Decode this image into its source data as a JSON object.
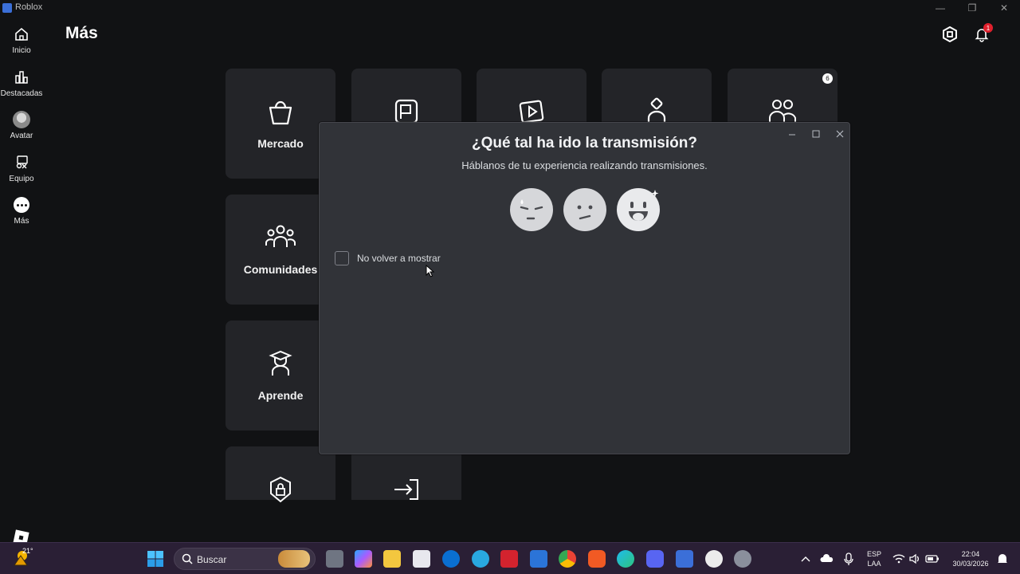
{
  "window": {
    "title": "Roblox",
    "minimize_glyph": "—",
    "restore_glyph": "❐",
    "close_glyph": "✕"
  },
  "sidebar": {
    "items": [
      {
        "label": "Inicio",
        "icon": "home-icon"
      },
      {
        "label": "Destacadas",
        "icon": "bar-chart-icon"
      },
      {
        "label": "Avatar",
        "icon": "avatar-icon"
      },
      {
        "label": "Equipo",
        "icon": "inventory-icon"
      },
      {
        "label": "Más",
        "icon": "more-icon"
      }
    ]
  },
  "header": {
    "title": "Más",
    "notification_count": "1"
  },
  "tiles": [
    {
      "label": "Mercado",
      "icon": "shopping-bag-icon"
    },
    {
      "label": "",
      "icon": "robux-card-icon"
    },
    {
      "label": "",
      "icon": "play-video-icon"
    },
    {
      "label": "",
      "icon": "person-icon"
    },
    {
      "label": "",
      "icon": "friends-icon",
      "badge": "6"
    },
    {
      "label": "Comunidades",
      "icon": "communities-icon"
    },
    {
      "label": "Aprende",
      "icon": "graduation-icon"
    },
    {
      "label": "",
      "icon": "lock-shield-icon"
    },
    {
      "label": "",
      "icon": "sign-in-icon"
    }
  ],
  "dialog": {
    "title": "¿Qué tal ha ido la transmisión?",
    "subtitle": "Háblanos de tu experiencia realizando transmisiones.",
    "faces": [
      "sad-face-icon",
      "neutral-face-icon",
      "happy-face-icon"
    ],
    "checkbox_label": "No volver a mostrar",
    "checkbox_checked": false
  },
  "taskbar": {
    "weather_temp": "21°",
    "search_placeholder": "Buscar",
    "language_top": "ESP",
    "language_bottom": "LAA",
    "time": "22:04",
    "date": "30/03/2026"
  },
  "colors": {
    "background": "#111214",
    "tile": "#232428",
    "dialog": "#313338",
    "taskbar": "#2a1f35",
    "notification": "#e0202d"
  }
}
